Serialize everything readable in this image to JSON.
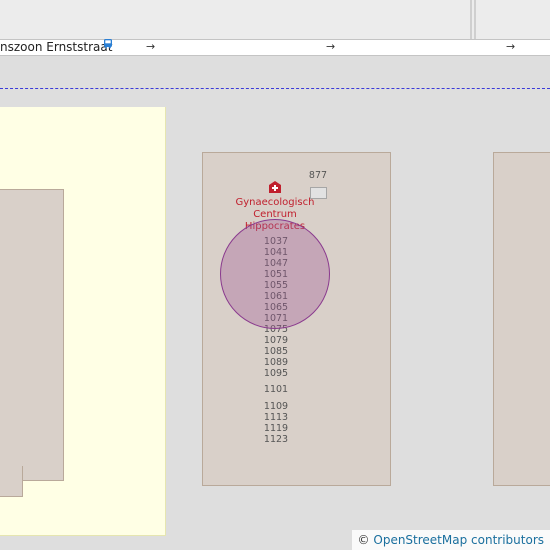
{
  "map": {
    "street_name": "nszoon Ernststraat",
    "oneway_arrow": "→",
    "house_numbers_right": "877",
    "poi": {
      "name": "Gynaecologisch Centrum Hippocrates",
      "icon": "hospital-icon",
      "color": "#c0202e"
    },
    "house_numbers": [
      "1037",
      "1041",
      "1047",
      "1051",
      "1055",
      "1061",
      "1065",
      "1071",
      "1075",
      "1079",
      "1085",
      "1089",
      "1095",
      "1101",
      "1109",
      "1113",
      "1119",
      "1123"
    ],
    "attribution": {
      "symbol": "©",
      "text": "OpenStreetMap contributors"
    },
    "colors": {
      "building": "#d9d0c9",
      "zone": "#ffffe5",
      "boundary": "#3b3bd8",
      "marker": "#8a3a8e"
    }
  }
}
